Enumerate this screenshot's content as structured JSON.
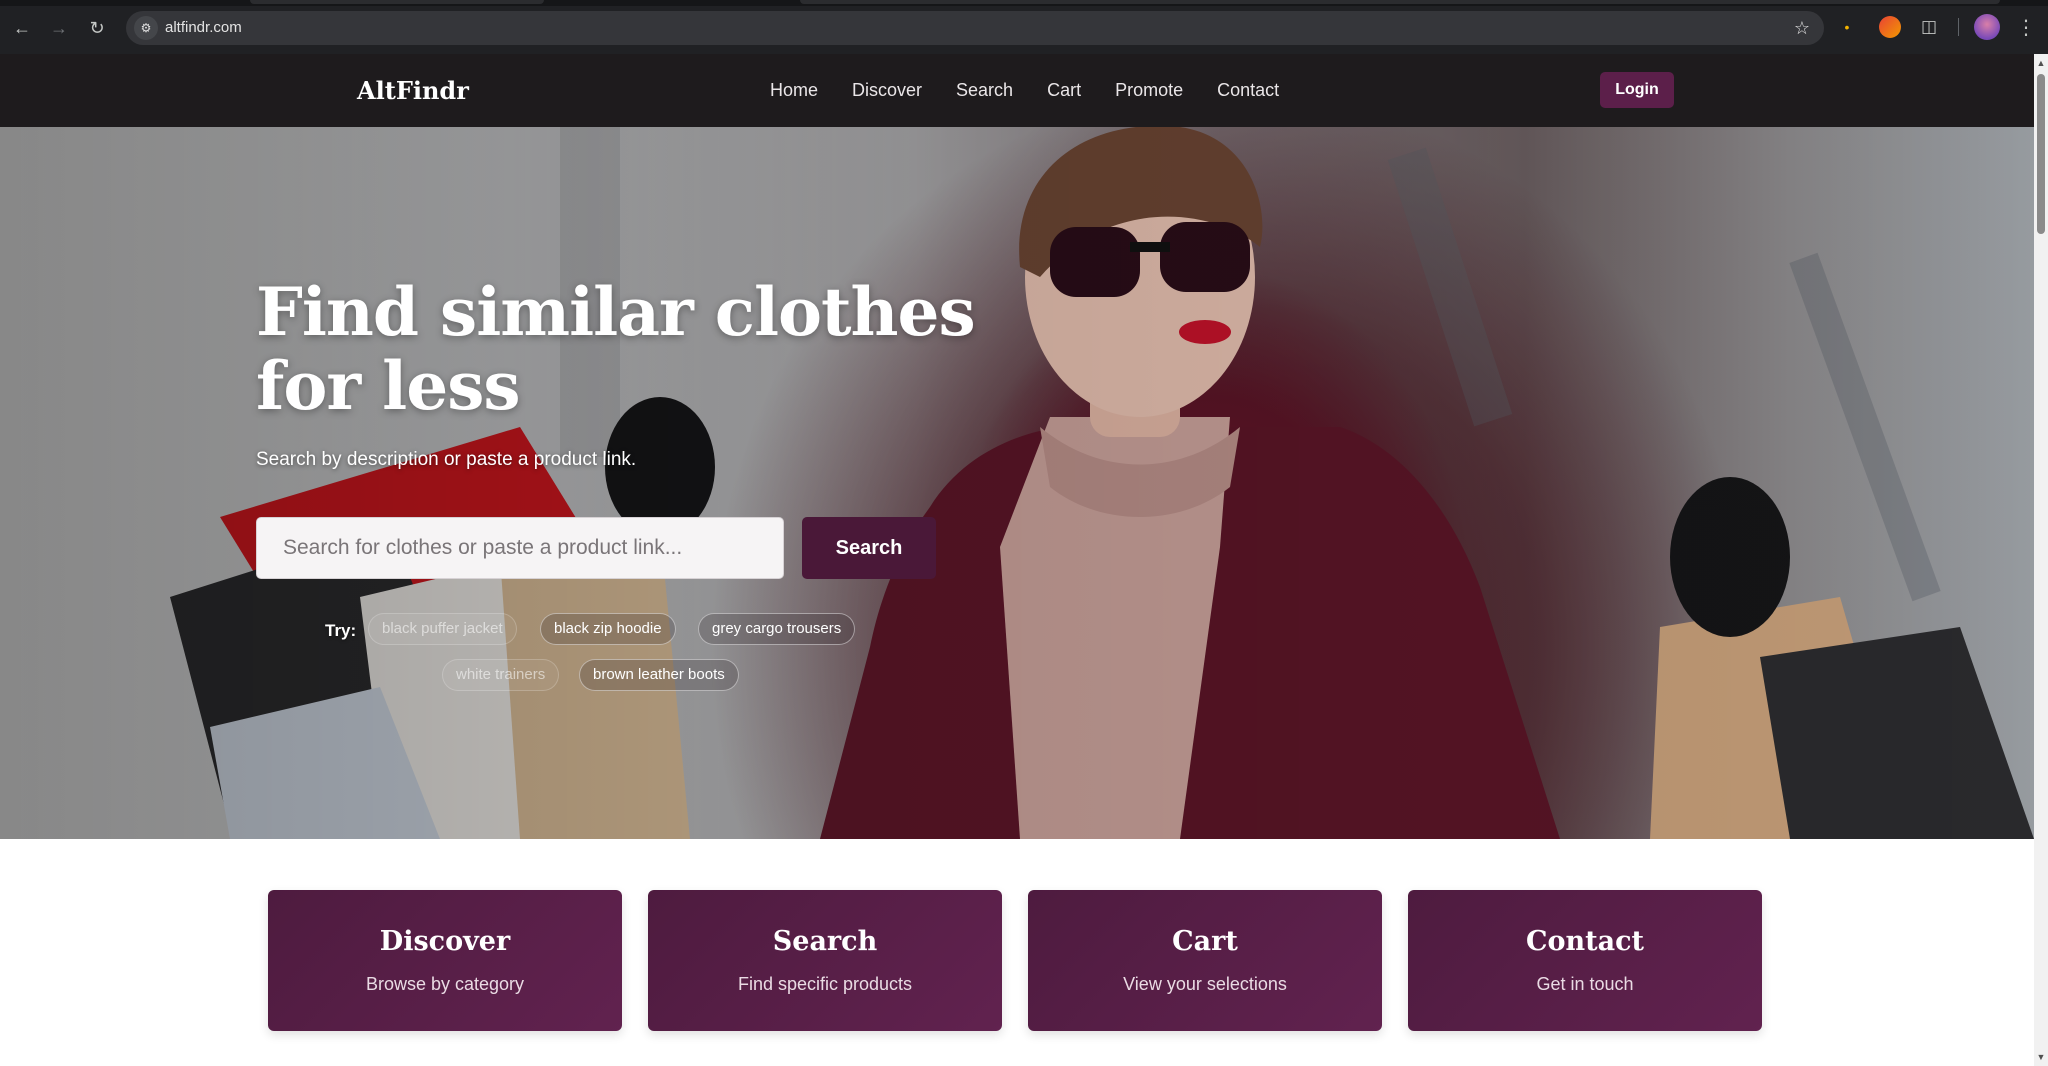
{
  "browser": {
    "url": "altfindr.com",
    "back_icon": "arrow-left-icon",
    "forward_icon": "arrow-right-icon",
    "reload_icon": "reload-icon",
    "site_info_icon": "site-settings-icon",
    "bookmark_icon": "star-icon",
    "extensions_icon": "puzzle-icon",
    "menu_icon": "kebab-menu-icon"
  },
  "header": {
    "logo": "AltFindr",
    "nav": [
      "Home",
      "Discover",
      "Search",
      "Cart",
      "Promote",
      "Contact"
    ],
    "login": "Login"
  },
  "hero": {
    "title": "Find similar clothes for less",
    "subtitle": "Search by description or paste a product link.",
    "search_placeholder": "Search for clothes or paste a product link...",
    "search_button": "Search",
    "try_label": "Try:",
    "suggestions": [
      "black puffer jacket",
      "black zip hoodie",
      "grey cargo trousers",
      "white trainers",
      "brown leather boots"
    ]
  },
  "cards": [
    {
      "title": "Discover",
      "desc": "Browse by category"
    },
    {
      "title": "Search",
      "desc": "Find specific products"
    },
    {
      "title": "Cart",
      "desc": "View your selections"
    },
    {
      "title": "Contact",
      "desc": "Get in touch"
    }
  ],
  "colors": {
    "brand": "#4a1838",
    "header_bg": "#1e1b1d",
    "card_bg": "#5a1f49",
    "chrome_bg": "#202124"
  }
}
